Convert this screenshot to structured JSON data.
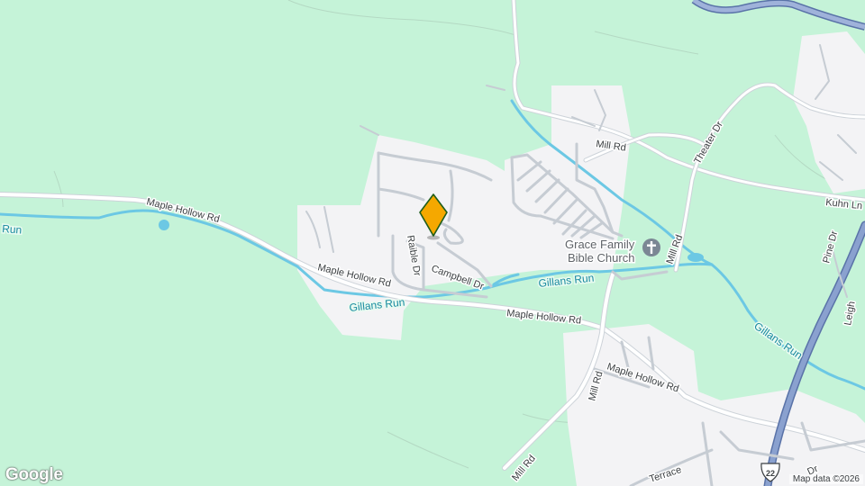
{
  "map": {
    "colors": {
      "land": "#c5f3d8",
      "urban": "#f3f3f5",
      "water": "#6cc8e4",
      "highway": "#6f87b8",
      "marker": "#f5a800"
    },
    "roads": {
      "maple_hollow_1": "Maple Hollow Rd",
      "maple_hollow_2": "Maple Hollow Rd",
      "maple_hollow_3": "Maple Hollow Rd",
      "maple_hollow_4": "Maple Hollow Rd",
      "raible": "Raible Dr",
      "campbell": "Campbell Dr",
      "mill_1": "Mill Rd",
      "mill_2": "Mill Rd",
      "mill_3": "Mill Rd",
      "mill_4": "Mill Rd",
      "theater": "Theater Dr",
      "kuhn": "Kuhn Ln",
      "pine": "Pine Dr",
      "leigh": "Leigh",
      "terrace": "Terrace",
      "dr": "Dr"
    },
    "water": {
      "run_left": "Run",
      "gillans_1": "Gillans Run",
      "gillans_2": "Gillans Run",
      "gillans_3": "Gillans Run"
    },
    "poi": {
      "church_line1": "Grace Family",
      "church_line2": "Bible Church",
      "church_icon": "cross-icon"
    },
    "highway_shield": "22",
    "marker_icon": "location-pin-icon",
    "logo": "Google",
    "attribution": "Map data ©2026"
  }
}
